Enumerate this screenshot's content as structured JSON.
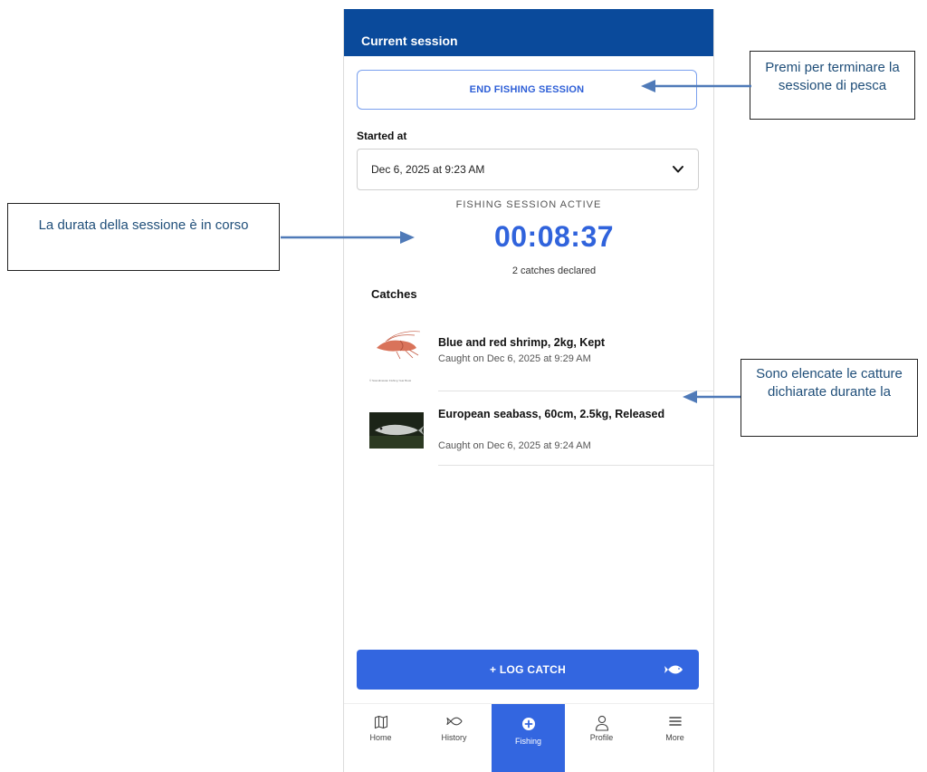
{
  "header": {
    "title": "Current session"
  },
  "session": {
    "end_button": "END FISHING SESSION",
    "started_label": "Started at",
    "started_value": "Dec 6, 2025 at 9:23 AM",
    "status": "FISHING SESSION ACTIVE",
    "timer": "00:08:37",
    "catches_count": "2 catches declared"
  },
  "catches": {
    "title": "Catches",
    "items": [
      {
        "title": "Blue and red shrimp, 2kg, Kept",
        "subtitle": "Caught on Dec 6, 2025 at 9:29 AM",
        "image_caption": "© Scandinavian Fishing Year Book"
      },
      {
        "title": "European seabass, 60cm, 2.5kg, Released",
        "subtitle": "Caught on Dec 6, 2025 at 9:24 AM"
      }
    ]
  },
  "log_catch": {
    "label": "+ LOG CATCH"
  },
  "tabs": [
    {
      "label": "Home",
      "icon": "map-icon"
    },
    {
      "label": "History",
      "icon": "fish-outline-icon"
    },
    {
      "label": "Fishing",
      "icon": "plus-circle-icon"
    },
    {
      "label": "Profile",
      "icon": "person-icon"
    },
    {
      "label": "More",
      "icon": "menu-icon"
    }
  ],
  "annotations": {
    "end_session": "Premi per terminare la sessione di pesca",
    "duration": "La durata della sessione è in corso",
    "catches": "Sono elencate le catture dichiarate durante la"
  },
  "colors": {
    "header": "#0a4a9b",
    "accent": "#3366e0",
    "timer": "#3063dc",
    "annotation_text": "#1f4e79"
  }
}
